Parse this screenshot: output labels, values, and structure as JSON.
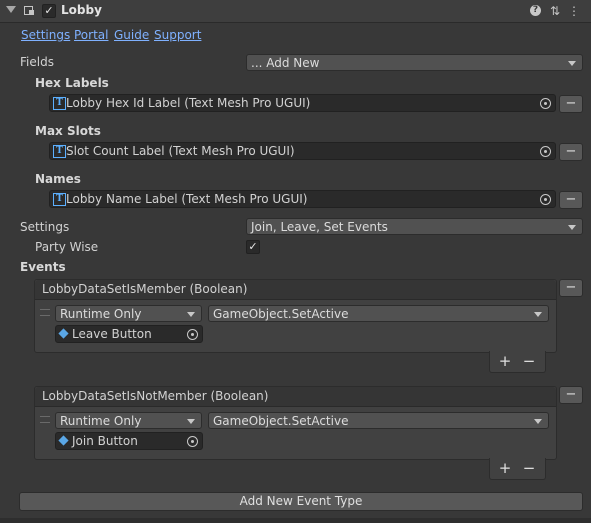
{
  "component": {
    "title": "Lobby",
    "enabled": true
  },
  "links": [
    "Settings",
    "Portal",
    "Guide",
    "Support"
  ],
  "fields": {
    "label": "Fields",
    "dropdown": "... Add New",
    "groups": [
      {
        "title": "Hex Labels",
        "value": "Lobby Hex Id Label (Text Mesh Pro UGUI)"
      },
      {
        "title": "Max Slots",
        "value": "Slot Count Label (Text Mesh Pro UGUI)"
      },
      {
        "title": "Names",
        "value": "Lobby Name Label (Text Mesh Pro UGUI)"
      }
    ]
  },
  "settings": {
    "label": "Settings",
    "dropdown": "Join, Leave, Set Events"
  },
  "party_wise": {
    "label": "Party Wise",
    "checked": true
  },
  "events": {
    "label": "Events",
    "items": [
      {
        "title": "LobbyDataSetIsMember (Boolean)",
        "runtime": "Runtime Only",
        "function": "GameObject.SetActive",
        "object": "Leave Button"
      },
      {
        "title": "LobbyDataSetIsNotMember (Boolean)",
        "runtime": "Runtime Only",
        "function": "GameObject.SetActive",
        "object": "Join Button"
      }
    ],
    "add_button": "Add New Event Type"
  },
  "symbols": {
    "minus": "−",
    "plus": "+",
    "check": "✓",
    "help": "?",
    "presets": "⇅",
    "more": "⋮",
    "tmp": "T"
  },
  "icons": [
    "foldout-arrow-icon",
    "script-icon",
    "help-icon",
    "presets-icon",
    "more-icon",
    "text-mesh-pro-icon",
    "target-icon",
    "gameobject-icon",
    "drag-handle-icon"
  ]
}
